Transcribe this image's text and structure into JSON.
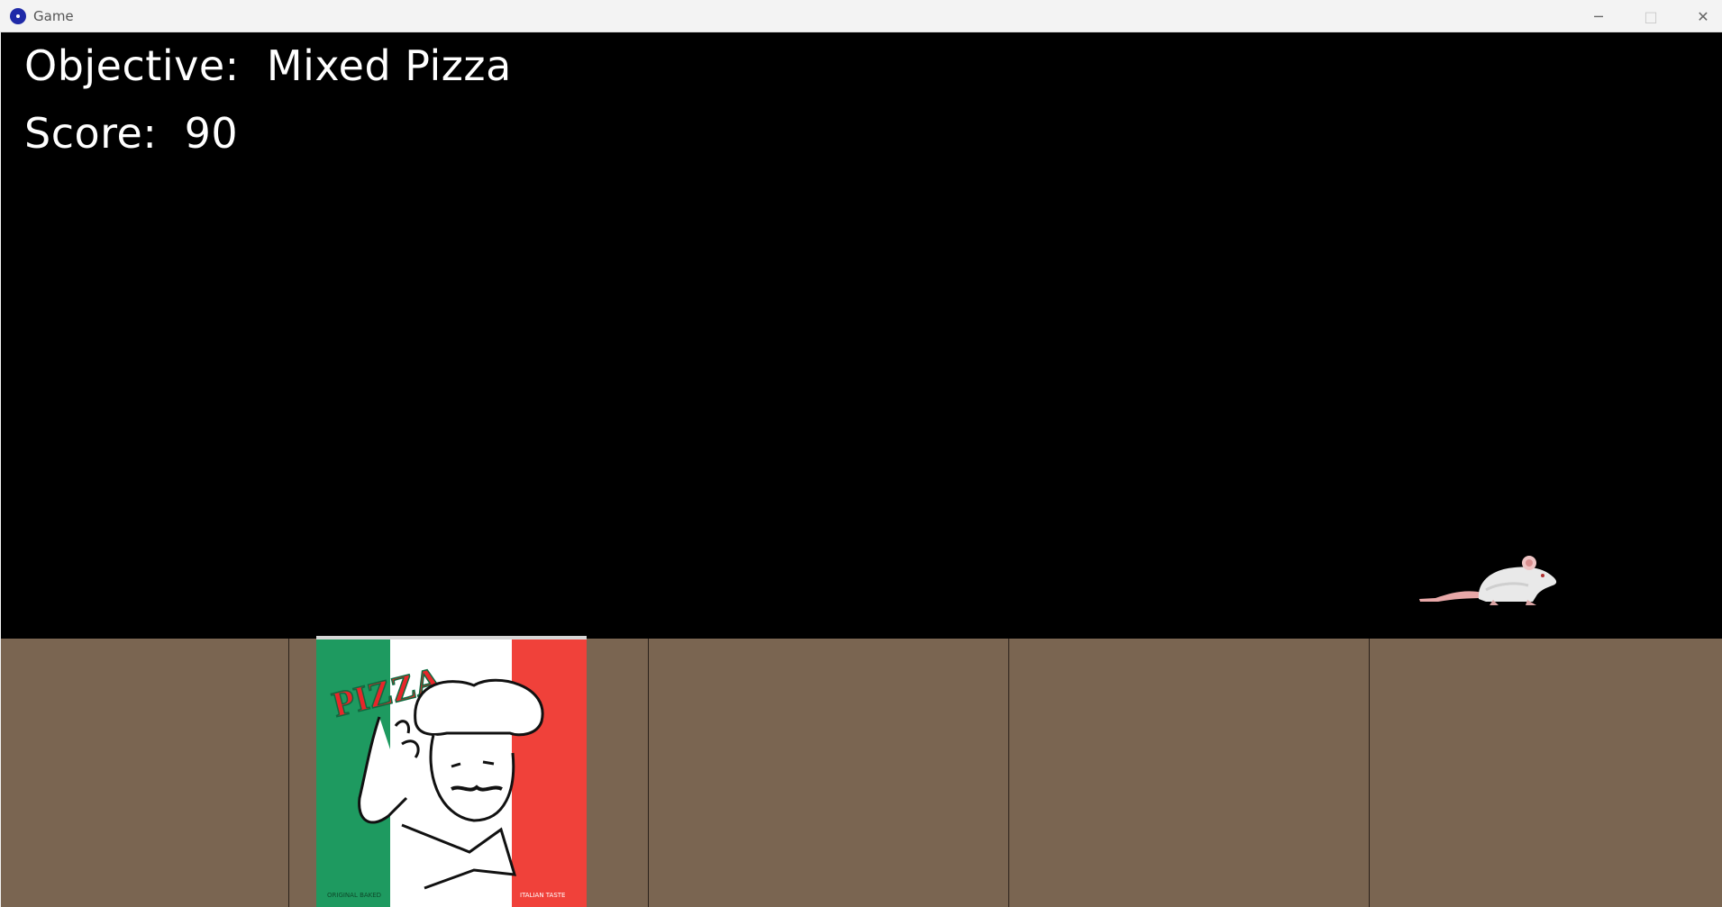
{
  "window": {
    "title": "Game",
    "app_icon": "app-icon",
    "controls": {
      "minimize": "─",
      "maximize": "□",
      "close": "✕"
    }
  },
  "hud": {
    "objective_label": "Objective:",
    "objective_value": "Mixed Pizza",
    "score_label": "Score:",
    "score_value": "90"
  },
  "sprites": {
    "pizza_box": {
      "text": "PIZZA",
      "name": "pizza-box-icon"
    },
    "rat": {
      "name": "rat-icon"
    }
  },
  "colors": {
    "background": "#000000",
    "counter": "#7a6551",
    "box_green": "#1e9a60",
    "box_red": "#f0413a"
  }
}
